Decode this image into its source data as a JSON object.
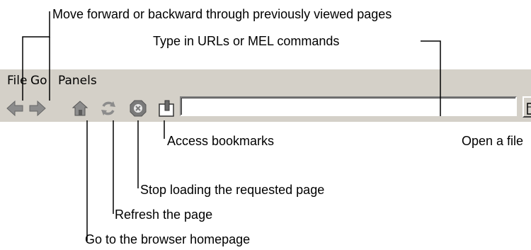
{
  "menu": {
    "items": [
      "File",
      "Go",
      "Panels"
    ]
  },
  "toolbar": {
    "buttons": [
      {
        "icon": "back-arrow-icon"
      },
      {
        "icon": "forward-arrow-icon"
      },
      {
        "icon": "home-icon"
      },
      {
        "icon": "refresh-icon"
      },
      {
        "icon": "stop-icon"
      },
      {
        "icon": "bookmarks-icon"
      }
    ],
    "url_value": "",
    "open_icon": "folder-icon"
  },
  "callouts": {
    "navigate": "Move forward or backward through previously viewed pages",
    "url": "Type in URLs or MEL commands",
    "bookmarks": "Access bookmarks",
    "open": "Open a file",
    "stop": "Stop loading the requested page",
    "refresh": "Refresh the page",
    "home": "Go to the browser homepage"
  }
}
